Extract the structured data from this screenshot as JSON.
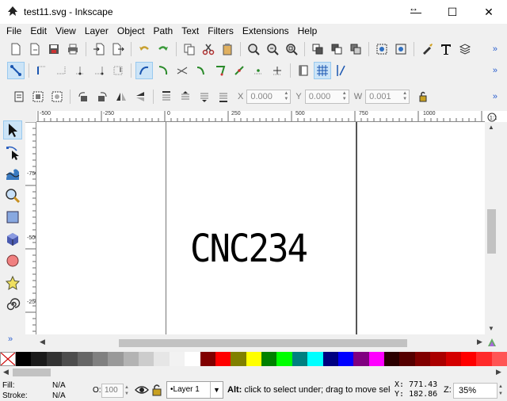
{
  "window": {
    "title": "test11.svg - Inkscape",
    "controls": {
      "resize": "↔",
      "minimize": "—",
      "maximize": "☐",
      "close": "✕"
    }
  },
  "menu": [
    "File",
    "Edit",
    "View",
    "Layer",
    "Object",
    "Path",
    "Text",
    "Filters",
    "Extensions",
    "Help"
  ],
  "toolbar_more": "»",
  "selector_controls": {
    "x_label": "X",
    "x_value": "0.000",
    "y_label": "Y",
    "y_value": "0.000",
    "w_label": "W",
    "w_value": "0.001"
  },
  "ruler": {
    "h_labels": [
      "-500",
      "-250",
      "0",
      "250",
      "500",
      "750",
      "1000"
    ],
    "v_labels": [
      "-750",
      "-500",
      "-250"
    ]
  },
  "canvas": {
    "text": "CNC234"
  },
  "palette": {
    "colors": [
      "#000000",
      "#1a1a1a",
      "#333333",
      "#4d4d4d",
      "#666666",
      "#808080",
      "#999999",
      "#b3b3b3",
      "#cccccc",
      "#e6e6e6",
      "#f2f2f2",
      "#ffffff",
      "#800000",
      "#ff0000",
      "#808000",
      "#ffff00",
      "#008000",
      "#00ff00",
      "#008080",
      "#00ffff",
      "#000080",
      "#0000ff",
      "#800080",
      "#ff00ff",
      "#2b0000",
      "#550000",
      "#800000",
      "#aa0000",
      "#d40000",
      "#ff0000",
      "#ff2a2a",
      "#ff5555"
    ]
  },
  "status": {
    "fill_label": "Fill:",
    "fill_value": "N/A",
    "stroke_label": "Stroke:",
    "stroke_value": "N/A",
    "opacity_label": "O:",
    "opacity_value": "100",
    "layer": "•Layer 1",
    "message_bold": "Alt:",
    "message": " click to select under; drag to move selected or select by touch",
    "x_label": "X:",
    "x_value": "771.43",
    "y_label": "Y:",
    "y_value": "182.86",
    "zoom_label": "Z:",
    "zoom_value": "35%"
  }
}
